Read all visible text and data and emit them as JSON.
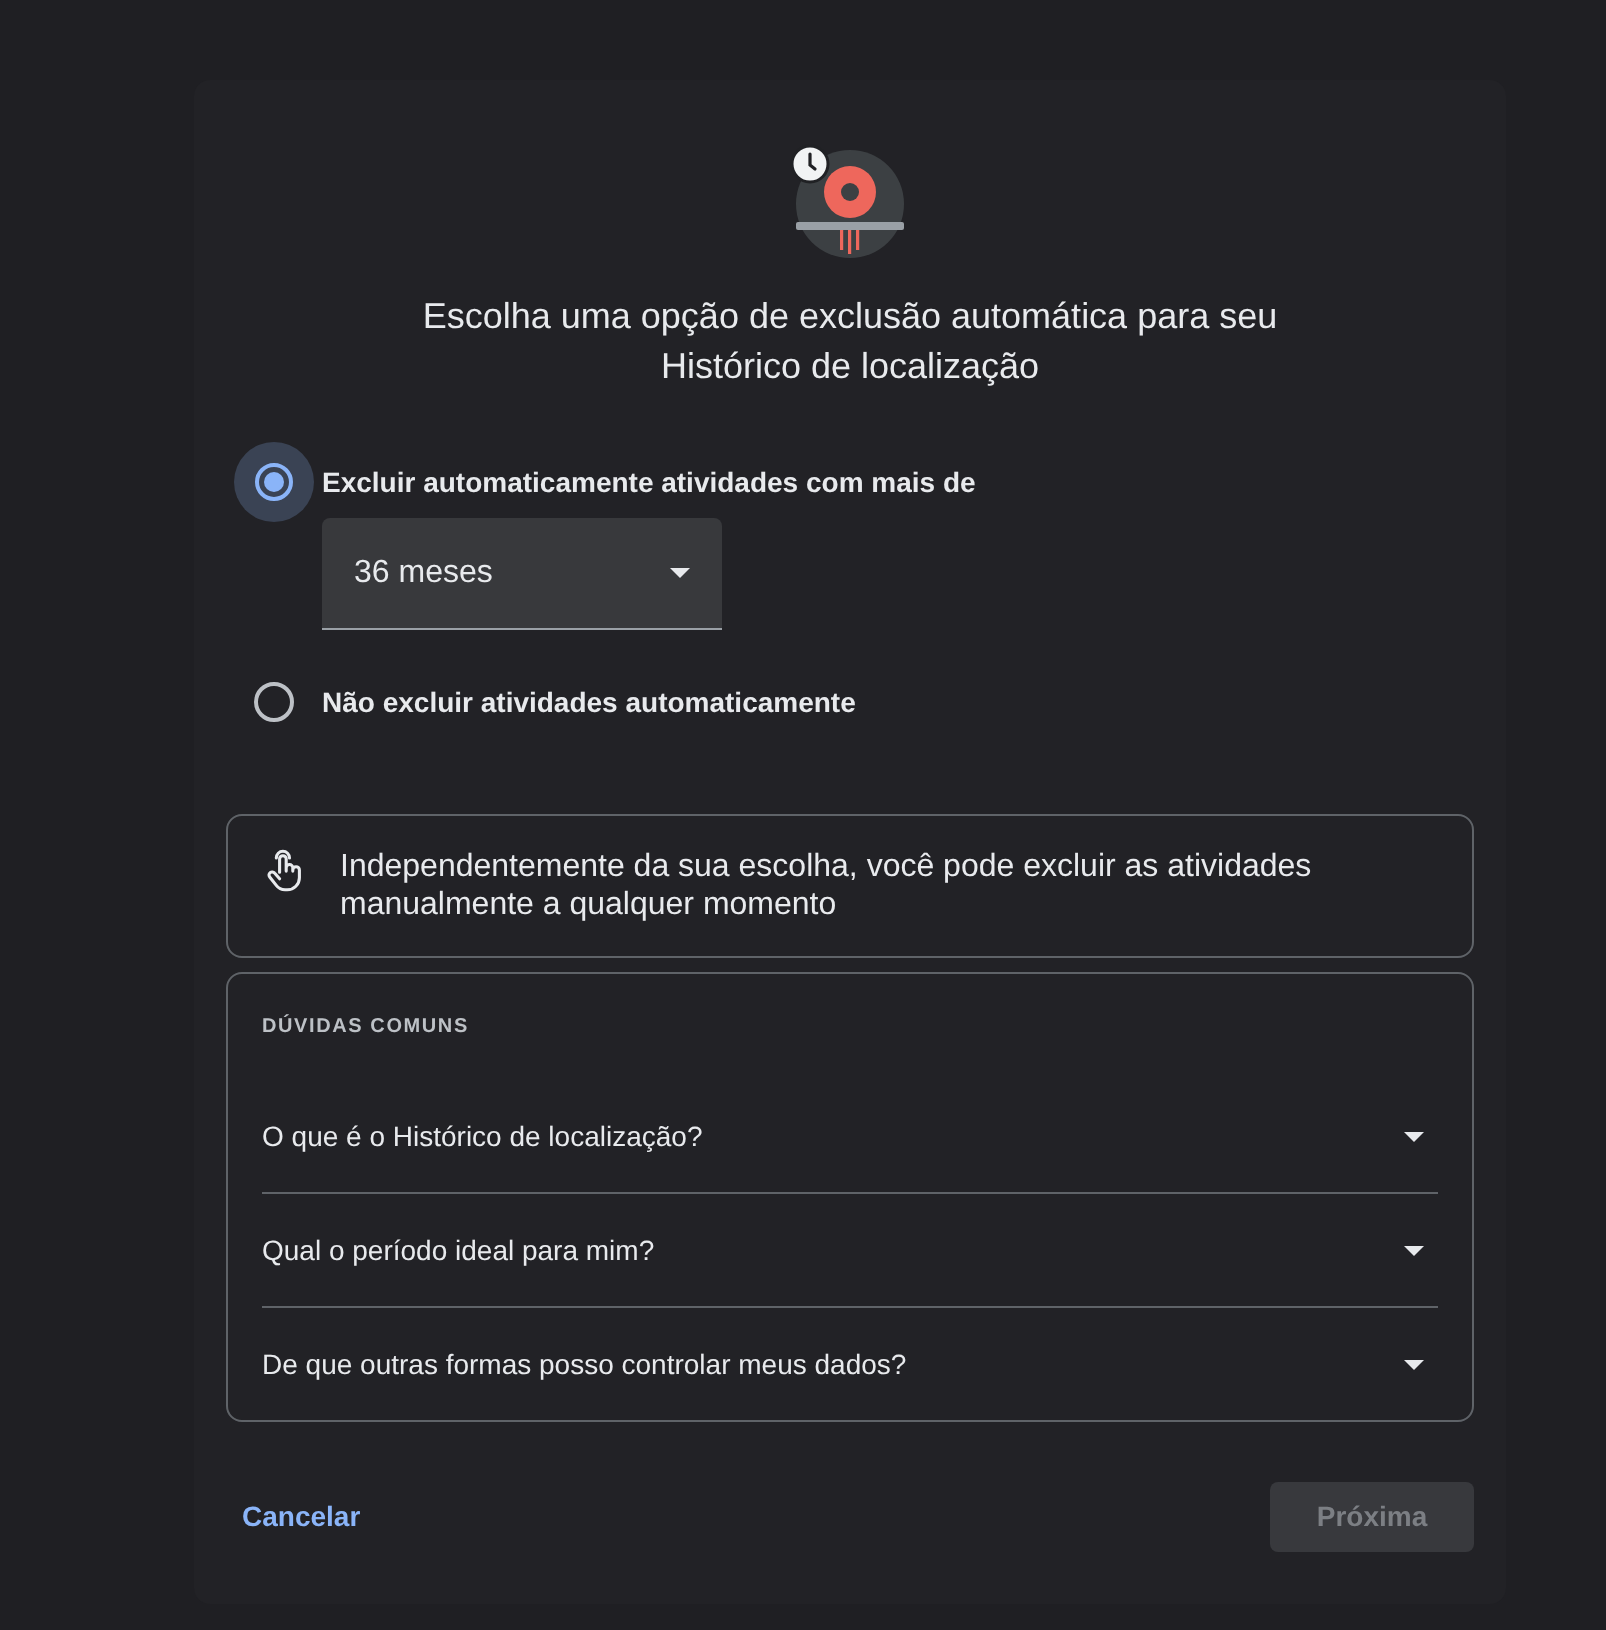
{
  "title": "Escolha uma opção de exclusão automática para seu Histórico de localização",
  "options": [
    {
      "label": "Excluir automaticamente atividades com mais de",
      "selected": true,
      "dropdown": {
        "value": "36 meses"
      }
    },
    {
      "label": "Não excluir atividades automaticamente",
      "selected": false
    }
  ],
  "notice": {
    "text": "Independentemente da sua escolha, você pode excluir as atividades manualmente a qualquer momento"
  },
  "faq": {
    "heading": "DÚVIDAS COMUNS",
    "items": [
      {
        "question": "O que é o Histórico de localização?",
        "expanded": false
      },
      {
        "question": "Qual o período ideal para mim?",
        "expanded": false
      },
      {
        "question": "De que outras formas posso controlar meus dados?",
        "expanded": false
      }
    ]
  },
  "footer": {
    "cancel": {
      "label": "Cancelar"
    },
    "next": {
      "label": "Próxima",
      "disabled": true
    }
  }
}
